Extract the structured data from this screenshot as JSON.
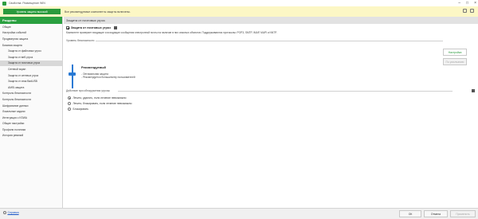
{
  "window": {
    "title": "Свойства: Размещение WIN",
    "icon": "app-icon"
  },
  "topbar": {
    "status_button": "Уровень защиты высокий",
    "message": "Все рекомендуемые компоненты защиты включены.",
    "color": "#fcf7c5",
    "status_color": "#2a9a3c"
  },
  "sidebar": {
    "header": "Разделы",
    "items": [
      {
        "label": "Общие",
        "level": 0
      },
      {
        "label": "Настройка событий",
        "level": 0
      },
      {
        "label": "Продвинутая защита",
        "level": 0
      },
      {
        "label": "Базовая защита",
        "level": 0
      },
      {
        "label": "Защита от файловых угроз",
        "level": 1
      },
      {
        "label": "Защита от веб-угроз",
        "level": 1
      },
      {
        "label": "Защита от почтовых угроз",
        "level": 1
      },
      {
        "label": "Сетевой экран",
        "level": 1
      },
      {
        "label": "Защита от сетевых угроз",
        "level": 1
      },
      {
        "label": "Защита от атак BadUSB",
        "level": 1
      },
      {
        "label": "AMSI-защита",
        "level": 1
      },
      {
        "label": "Контроль безопасности",
        "level": 0
      },
      {
        "label": "Контроль безопасности",
        "level": 0
      },
      {
        "label": "Шифрование данных",
        "level": 0
      },
      {
        "label": "Локальные задачи",
        "level": 0
      },
      {
        "label": "Интеграция с KSWA",
        "level": 0
      },
      {
        "label": "Общие настройки",
        "level": 0
      },
      {
        "label": "Профили политики",
        "level": 0
      },
      {
        "label": "История ревизий",
        "level": 0
      }
    ],
    "selected_index": 6,
    "header_color": "#2aa040"
  },
  "main": {
    "header": "Защита от почтовых угроз",
    "protect_label": "Защита от почтовых угроз",
    "description": "Компонент проверяет входящие и исходящие сообщения электронной почты на наличие в них опасных объектов. Поддерживаются протоколы: POP3, SMTP, IMAP, MAPI и NNTP.",
    "security_level": {
      "title": "Уровень безопасности",
      "name": "Рекомендуемый",
      "desc_line1": "- Оптимальная защита",
      "desc_line2": "- Рекомендуется большинству пользователей",
      "settings_button": "Настройка",
      "default_button": "По умолчанию",
      "slider_position": "middle"
    },
    "action": {
      "title": "Действие при обнаружении угрозы",
      "options": [
        "Лечить; удалять, если лечение невозможно",
        "Лечить; блокировать, если лечение невозможно",
        "Блокировать"
      ],
      "selected_index": 0
    }
  },
  "bottom": {
    "help": "Справка",
    "ok": "ОК",
    "cancel": "Отмена",
    "apply": "Применить"
  }
}
